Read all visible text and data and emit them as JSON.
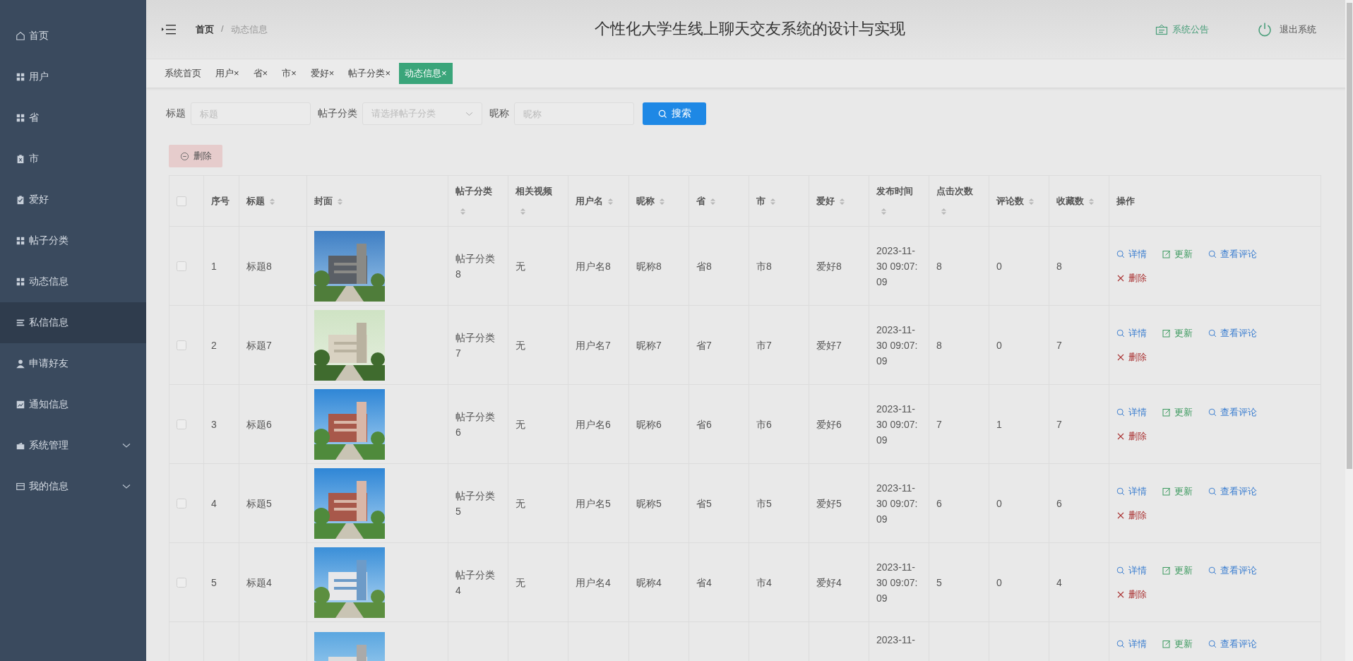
{
  "sidebar": {
    "items": [
      {
        "label": "首页",
        "kind": "link",
        "selected": false
      },
      {
        "label": "用户",
        "kind": "link",
        "selected": false
      },
      {
        "label": "省",
        "kind": "link",
        "selected": false
      },
      {
        "label": "市",
        "kind": "link",
        "selected": false
      },
      {
        "label": "爱好",
        "kind": "link",
        "selected": false
      },
      {
        "label": "帖子分类",
        "kind": "link",
        "selected": false
      },
      {
        "label": "动态信息",
        "kind": "link",
        "selected": false
      },
      {
        "label": "私信信息",
        "kind": "link",
        "selected": true
      },
      {
        "label": "申请好友",
        "kind": "link",
        "selected": false
      },
      {
        "label": "通知信息",
        "kind": "link",
        "selected": false
      },
      {
        "label": "系统管理",
        "kind": "submenu",
        "selected": false
      },
      {
        "label": "我的信息",
        "kind": "submenu",
        "selected": false
      }
    ]
  },
  "header": {
    "breadcrumb": [
      "首页",
      "动态信息"
    ],
    "separator": "/",
    "title": "个性化大学生线上聊天交友系统的设计与实现",
    "notice": "系统公告",
    "logout": "退出系统"
  },
  "tabs": [
    {
      "label": "系统首页",
      "selected": false
    },
    {
      "label": "用户",
      "close": "×",
      "selected": false
    },
    {
      "label": "省",
      "close": "×",
      "selected": false
    },
    {
      "label": "市",
      "close": "×",
      "selected": false
    },
    {
      "label": "爱好",
      "close": "×",
      "selected": false
    },
    {
      "label": "帖子分类",
      "close": "×",
      "selected": false
    },
    {
      "label": "动态信息",
      "close": "×",
      "selected": true
    }
  ],
  "filters": [
    {
      "label": "标题",
      "kind": "text",
      "placeholder": "标题"
    },
    {
      "label": "帖子分类",
      "kind": "select",
      "placeholder": "请选择帖子分类"
    },
    {
      "label": "昵称",
      "kind": "text",
      "placeholder": "昵称"
    }
  ],
  "search_button": "搜索",
  "delete_button": "删除",
  "table": {
    "header_checked": false,
    "columns": [
      {
        "label": "序号",
        "sortable": false
      },
      {
        "label": "标题",
        "sortable": true
      },
      {
        "label": "封面",
        "sortable": true
      },
      {
        "label": "帖子分类",
        "sortable": true
      },
      {
        "label": "相关视频",
        "sortable": true
      },
      {
        "label": "用户名",
        "sortable": true
      },
      {
        "label": "昵称",
        "sortable": true
      },
      {
        "label": "省",
        "sortable": true
      },
      {
        "label": "市",
        "sortable": true
      },
      {
        "label": "爱好",
        "sortable": true
      },
      {
        "label": "发布时间",
        "sortable": true
      },
      {
        "label": "点击次数",
        "sortable": true
      },
      {
        "label": "评论数",
        "sortable": true
      },
      {
        "label": "收藏数",
        "sortable": true
      },
      {
        "label": "操作",
        "sortable": false
      }
    ],
    "rows": [
      {
        "checked": false,
        "cells": [
          "1",
          "标题8",
          {
            "kind": "picture"
          },
          "帖子分类8",
          "无",
          "用户名8",
          "昵称8",
          "省8",
          "市8",
          "爱好8",
          "2023-11-30 09:07:09",
          "8",
          "0",
          "8"
        ],
        "actions": [
          {
            "kind": "detail",
            "label": "详情"
          },
          {
            "kind": "update",
            "label": "更新"
          },
          {
            "kind": "comments",
            "label": "查看评论"
          },
          {
            "kind": "delete",
            "label": "删除"
          }
        ]
      },
      {
        "checked": false,
        "cells": [
          "2",
          "标题7",
          {
            "kind": "picture"
          },
          "帖子分类7",
          "无",
          "用户名7",
          "昵称7",
          "省7",
          "市7",
          "爱好7",
          "2023-11-30 09:07:09",
          "8",
          "0",
          "7"
        ],
        "actions": [
          {
            "kind": "detail",
            "label": "详情"
          },
          {
            "kind": "update",
            "label": "更新"
          },
          {
            "kind": "comments",
            "label": "查看评论"
          },
          {
            "kind": "delete",
            "label": "删除"
          }
        ]
      },
      {
        "checked": false,
        "cells": [
          "3",
          "标题6",
          {
            "kind": "picture"
          },
          "帖子分类6",
          "无",
          "用户名6",
          "昵称6",
          "省6",
          "市6",
          "爱好6",
          "2023-11-30 09:07:09",
          "7",
          "1",
          "7"
        ],
        "actions": [
          {
            "kind": "detail",
            "label": "详情"
          },
          {
            "kind": "update",
            "label": "更新"
          },
          {
            "kind": "comments",
            "label": "查看评论"
          },
          {
            "kind": "delete",
            "label": "删除"
          }
        ]
      },
      {
        "checked": false,
        "cells": [
          "4",
          "标题5",
          {
            "kind": "picture"
          },
          "帖子分类5",
          "无",
          "用户名5",
          "昵称5",
          "省5",
          "市5",
          "爱好5",
          "2023-11-30 09:07:09",
          "6",
          "0",
          "6"
        ],
        "actions": [
          {
            "kind": "detail",
            "label": "详情"
          },
          {
            "kind": "update",
            "label": "更新"
          },
          {
            "kind": "comments",
            "label": "查看评论"
          },
          {
            "kind": "delete",
            "label": "删除"
          }
        ]
      },
      {
        "checked": false,
        "cells": [
          "5",
          "标题4",
          {
            "kind": "picture"
          },
          "帖子分类4",
          "无",
          "用户名4",
          "昵称4",
          "省4",
          "市4",
          "爱好4",
          "2023-11-30 09:07:09",
          "5",
          "0",
          "4"
        ],
        "actions": [
          {
            "kind": "detail",
            "label": "详情"
          },
          {
            "kind": "update",
            "label": "更新"
          },
          {
            "kind": "comments",
            "label": "查看评论"
          },
          {
            "kind": "delete",
            "label": "删除"
          }
        ]
      },
      {
        "cells": [
          null,
          null,
          {
            "kind": "picture"
          },
          null,
          null,
          null,
          null,
          null,
          null,
          null,
          "2023-11-",
          null,
          null,
          null
        ],
        "actions": [
          {
            "kind": "detail",
            "label": "详情"
          },
          {
            "kind": "update",
            "label": "更新"
          },
          {
            "kind": "comments",
            "label": "查看评论"
          }
        ]
      }
    ]
  }
}
